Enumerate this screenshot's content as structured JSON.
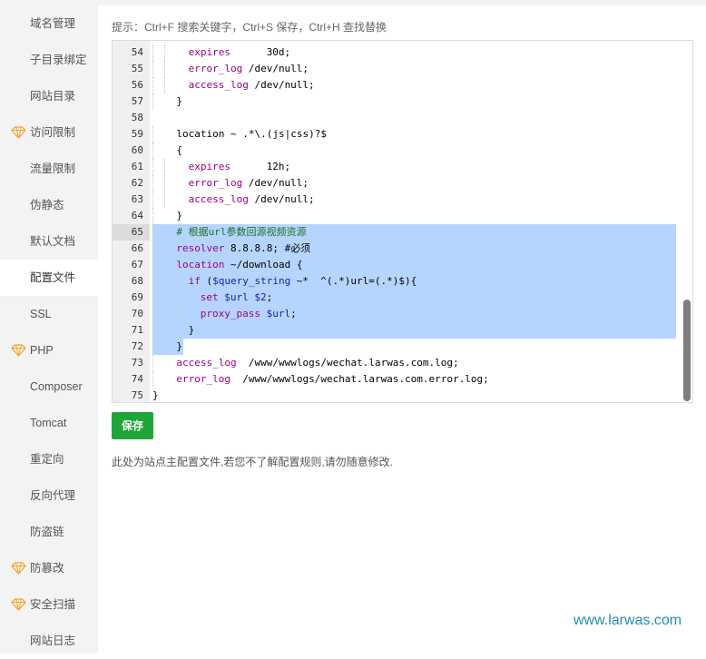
{
  "sidebar": {
    "items": [
      {
        "label": "域名管理",
        "premium": false,
        "active": false
      },
      {
        "label": "子目录绑定",
        "premium": false,
        "active": false
      },
      {
        "label": "网站目录",
        "premium": false,
        "active": false
      },
      {
        "label": "访问限制",
        "premium": true,
        "active": false
      },
      {
        "label": "流量限制",
        "premium": false,
        "active": false
      },
      {
        "label": "伪静态",
        "premium": false,
        "active": false
      },
      {
        "label": "默认文档",
        "premium": false,
        "active": false
      },
      {
        "label": "配置文件",
        "premium": false,
        "active": true
      },
      {
        "label": "SSL",
        "premium": false,
        "active": false
      },
      {
        "label": "PHP",
        "premium": true,
        "active": false
      },
      {
        "label": "Composer",
        "premium": false,
        "active": false
      },
      {
        "label": "Tomcat",
        "premium": false,
        "active": false
      },
      {
        "label": "重定向",
        "premium": false,
        "active": false
      },
      {
        "label": "反向代理",
        "premium": false,
        "active": false
      },
      {
        "label": "防盗链",
        "premium": false,
        "active": false
      },
      {
        "label": "防篡改",
        "premium": true,
        "active": false
      },
      {
        "label": "安全扫描",
        "premium": true,
        "active": false
      },
      {
        "label": "网站日志",
        "premium": false,
        "active": false
      }
    ]
  },
  "tip": "提示：Ctrl+F 搜索关键字，Ctrl+S 保存，Ctrl+H 查找替换",
  "editor": {
    "current_line": 65,
    "selection": {
      "from": 65,
      "to": 72
    },
    "lines": [
      {
        "n": "54",
        "indent": 3,
        "tokens": [
          [
            "kw",
            "expires"
          ],
          [
            "",
            "      30d;"
          ]
        ]
      },
      {
        "n": "55",
        "indent": 3,
        "tokens": [
          [
            "kw",
            "error_log"
          ],
          [
            "",
            " /dev/null;"
          ]
        ]
      },
      {
        "n": "56",
        "indent": 3,
        "tokens": [
          [
            "kw",
            "access_log"
          ],
          [
            "",
            " /dev/null;"
          ]
        ]
      },
      {
        "n": "57",
        "indent": 2,
        "tokens": [
          [
            "",
            "}"
          ]
        ]
      },
      {
        "n": "58",
        "indent": 0,
        "tokens": []
      },
      {
        "n": "59",
        "indent": 2,
        "tokens": [
          [
            "",
            "location ~ .*\\.(js|css)?$"
          ]
        ]
      },
      {
        "n": "60",
        "indent": 2,
        "tokens": [
          [
            "",
            "{"
          ]
        ]
      },
      {
        "n": "61",
        "indent": 3,
        "tokens": [
          [
            "kw",
            "expires"
          ],
          [
            "",
            "      12h;"
          ]
        ]
      },
      {
        "n": "62",
        "indent": 3,
        "tokens": [
          [
            "kw",
            "error_log"
          ],
          [
            "",
            " /dev/null;"
          ]
        ]
      },
      {
        "n": "63",
        "indent": 3,
        "tokens": [
          [
            "kw",
            "access_log"
          ],
          [
            "",
            " /dev/null;"
          ]
        ]
      },
      {
        "n": "64",
        "indent": 2,
        "tokens": [
          [
            "",
            "}"
          ]
        ]
      },
      {
        "n": "65",
        "indent": 2,
        "tokens": [
          [
            "cm",
            "# 根据url参数回源视频资源"
          ]
        ]
      },
      {
        "n": "66",
        "indent": 2,
        "tokens": [
          [
            "kw",
            "resolver"
          ],
          [
            "",
            " 8.8.8.8; #必须"
          ]
        ]
      },
      {
        "n": "67",
        "indent": 2,
        "tokens": [
          [
            "kw",
            "location"
          ],
          [
            "",
            " ~/download {"
          ]
        ]
      },
      {
        "n": "68",
        "indent": 3,
        "tokens": [
          [
            "kw",
            "if"
          ],
          [
            "",
            " ("
          ],
          [
            "str",
            "$query_string"
          ],
          [
            "",
            " ~*  ^(.*)url=(.*)$){"
          ]
        ]
      },
      {
        "n": "69",
        "indent": 4,
        "tokens": [
          [
            "kw",
            "set"
          ],
          [
            "",
            " "
          ],
          [
            "str",
            "$url"
          ],
          [
            "",
            " "
          ],
          [
            "str",
            "$2"
          ],
          [
            "",
            ";"
          ]
        ]
      },
      {
        "n": "70",
        "indent": 4,
        "tokens": [
          [
            "kw",
            "proxy_pass"
          ],
          [
            "",
            " "
          ],
          [
            "str",
            "$url"
          ],
          [
            "",
            ";"
          ]
        ]
      },
      {
        "n": "71",
        "indent": 3,
        "tokens": [
          [
            "",
            "}"
          ]
        ]
      },
      {
        "n": "72",
        "indent": 2,
        "tokens": [
          [
            "",
            "}"
          ]
        ]
      },
      {
        "n": "73",
        "indent": 2,
        "tokens": [
          [
            "kw",
            "access_log"
          ],
          [
            "",
            "  /www/wwwlogs/wechat.larwas.com.log;"
          ]
        ]
      },
      {
        "n": "74",
        "indent": 2,
        "tokens": [
          [
            "kw",
            "error_log"
          ],
          [
            "",
            "  /www/wwwlogs/wechat.larwas.com.error.log;"
          ]
        ]
      },
      {
        "n": "75",
        "indent": 0,
        "tokens": [
          [
            "",
            "}"
          ]
        ]
      }
    ]
  },
  "save_label": "保存",
  "note": "此处为站点主配置文件,若您不了解配置规则,请勿随意修改.",
  "watermark": "www.larwas.com",
  "colors": {
    "save_button": "#20a53a",
    "selection": "#b5d5ff",
    "keyword": "#9a0089",
    "variable": "#1a1aa6",
    "comment": "#236e24",
    "watermark": "#1f8fb0"
  }
}
